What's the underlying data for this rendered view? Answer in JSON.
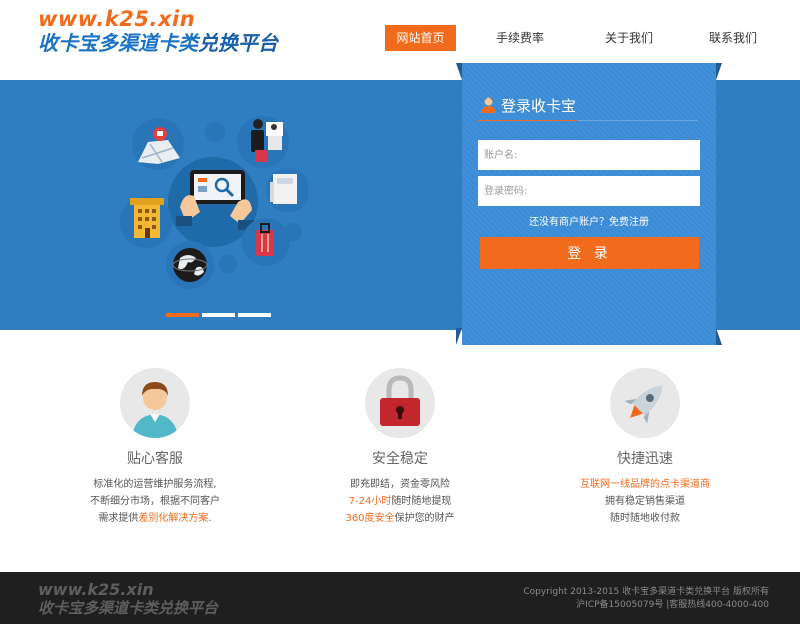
{
  "header": {
    "logo_url": "www.k25.xin",
    "logo_slogan_a": "收卡宝多渠道卡类",
    "logo_slogan_b": "兑换平台"
  },
  "nav": [
    {
      "label": "网站首页",
      "active": true
    },
    {
      "label": "手续费率",
      "active": false
    },
    {
      "label": "关于我们",
      "active": false
    },
    {
      "label": "联系我们",
      "active": false
    }
  ],
  "banner": {
    "slides_total": 3,
    "active_slide": 1
  },
  "login": {
    "title": "登录收卡宝",
    "account_placeholder": "账户名:",
    "password_placeholder": "登录密码:",
    "register_link": "还没有商户账户？免费注册",
    "submit_label": "登 录"
  },
  "features": [
    {
      "title": "贴心客服",
      "lines": [
        {
          "text": "标准化的运营维护服务流程,"
        },
        {
          "text": "不断细分市场，根据不同客户"
        },
        {
          "pre": "需求提供",
          "hl": "差别化解决方案",
          "post": "."
        }
      ]
    },
    {
      "title": "安全稳定",
      "lines": [
        {
          "text": "即充即结，资金零风险"
        },
        {
          "pre": "",
          "hl": "7-24小时",
          "post": "随时随地提现"
        },
        {
          "pre": "",
          "hl": "360度安全",
          "post": "保护您的财产"
        }
      ]
    },
    {
      "title": "快捷迅速",
      "lines": [
        {
          "pre": "",
          "hl": "互联网一线品牌的点卡渠道商",
          "post": ""
        },
        {
          "text": "拥有稳定销售渠道"
        },
        {
          "text": "随时随地收付款"
        }
      ]
    }
  ],
  "footer": {
    "logo_url": "www.k25.xin",
    "logo_slogan": "收卡宝多渠道卡类兑换平台",
    "copyright": "Copyright 2013-2015 收卡宝多渠道卡类兑换平台 版权所有",
    "icp": "沪ICP备15005079号 |客服热线400-4000-400"
  },
  "colors": {
    "accent": "#f26b1d",
    "banner": "#2f7ec1",
    "footer": "#1f1f1f"
  }
}
